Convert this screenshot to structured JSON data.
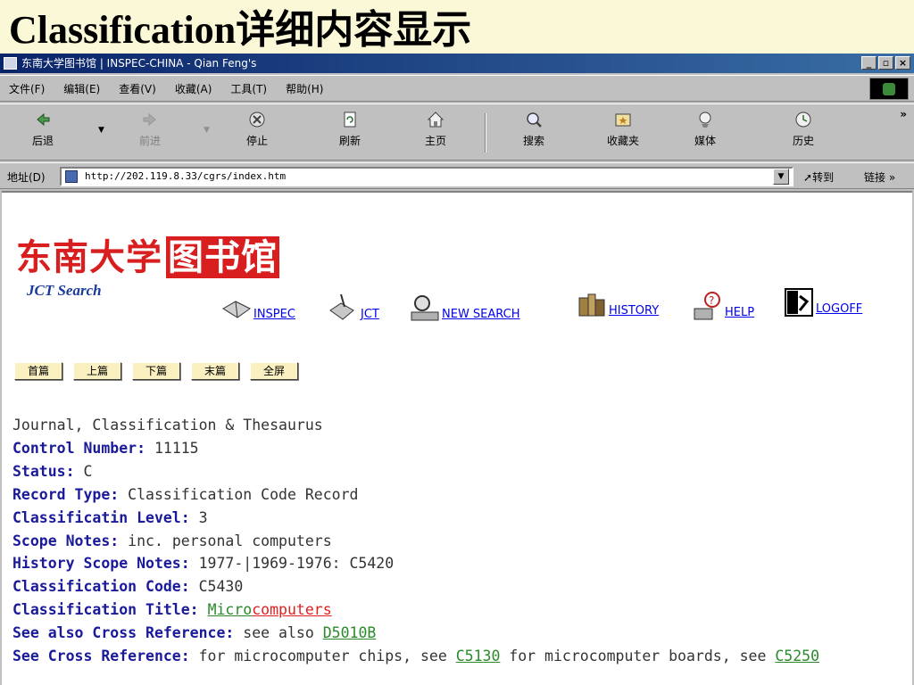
{
  "slide": {
    "title": "Classification详细内容显示"
  },
  "window": {
    "title": "东南大学图书馆 | INSPEC-CHINA - Qian Feng's",
    "controls": {
      "minimize": "_",
      "maximize": "▫",
      "close": "×"
    }
  },
  "menu": [
    "文件(F)",
    "编辑(E)",
    "查看(V)",
    "收藏(A)",
    "工具(T)",
    "帮助(H)"
  ],
  "toolbar": {
    "back": "后退",
    "forward": "前进",
    "stop": "停止",
    "refresh": "刷新",
    "home": "主页",
    "search": "搜索",
    "favorites": "收藏夹",
    "media": "媒体",
    "history": "历史",
    "more": "»"
  },
  "address": {
    "label": "地址(D)",
    "url": "http://202.119.8.33/cgrs/index.htm",
    "go": "转到",
    "links": "链接 »"
  },
  "page": {
    "logo_cn_1": "东南大学",
    "logo_cn_2": "图书馆",
    "logo_sub": "JCT Search",
    "nav": {
      "inspec": "INSPEC",
      "jct": "JCT",
      "new_search": "NEW SEARCH",
      "history": "HISTORY",
      "help": "HELP",
      "logoff": "LOGOFF"
    },
    "pager": [
      "首篇",
      "上篇",
      "下篇",
      "末篇",
      "全屏"
    ]
  },
  "record": {
    "heading": "Journal, Classification & Thesaurus",
    "control_number": {
      "label": "Control Number:",
      "value": " 11115"
    },
    "status": {
      "label": "Status:",
      "value": " C"
    },
    "record_type": {
      "label": "Record Type:",
      "value": " Classification Code Record"
    },
    "level": {
      "label": "Classificatin Level:",
      "value": " 3"
    },
    "scope_notes": {
      "label": "Scope Notes:",
      "value": " inc. personal computers"
    },
    "history_scope": {
      "label": "History Scope Notes:",
      "value": " 1977-|1969-1976: C5420"
    },
    "code": {
      "label": "Classification Code:",
      "value": " C5430"
    },
    "title": {
      "label": "Classification Title:",
      "value_part1": "Micro",
      "value_part2": "computers"
    },
    "see_also": {
      "label": "See also Cross Reference:",
      "text": " see also ",
      "link": "D5010B"
    },
    "see": {
      "label": "See Cross Reference:",
      "text1": " for microcomputer chips, see ",
      "link1": "C5130",
      "text2": " for microcomputer boards, see ",
      "link2": "C5250"
    }
  }
}
